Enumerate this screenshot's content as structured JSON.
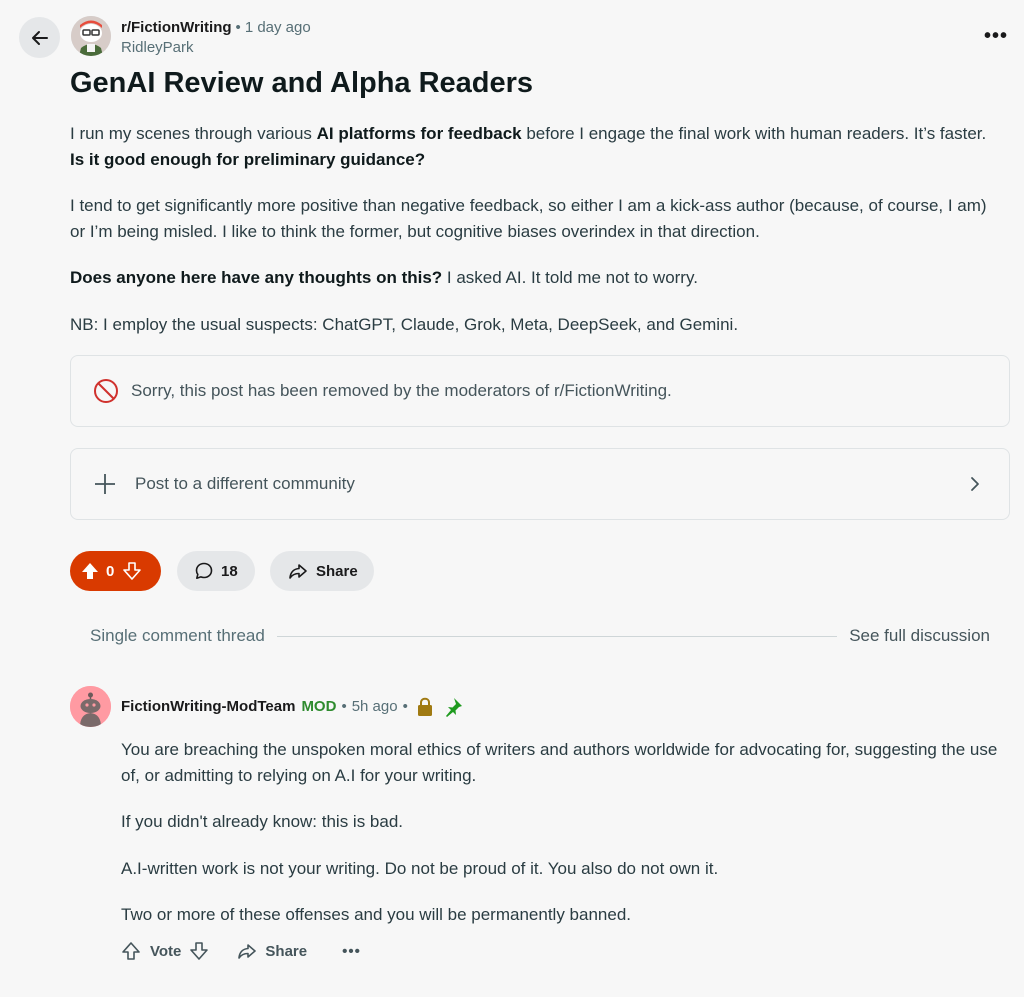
{
  "post": {
    "subreddit": "r/FictionWriting",
    "separator": "•",
    "time": "1 day ago",
    "author": "RidleyPark",
    "more": "•••",
    "title": "GenAI Review and Alpha Readers",
    "p1_a": "I run my scenes through various ",
    "p1_b": "AI platforms for feedback",
    "p1_c": " before I engage the final work with human readers. It’s faster. ",
    "p1_d": "Is it good enough for preliminary guidance?",
    "p2": "I tend to get significantly more positive than negative feedback, so either I am a kick-ass author (because, of course, I am) or I’m being misled. I like to think the former, but cognitive biases overindex in that direction.",
    "p3_a": "Does anyone here have any thoughts on this?",
    "p3_b": " I asked AI. It told me not to worry.",
    "p4": "NB: I employ the usual suspects: ChatGPT, Claude, Grok, Meta, DeepSeek, and Gemini."
  },
  "removed_notice": "Sorry, this post has been removed by the moderators of r/FictionWriting.",
  "crosspost_label": "Post to a different community",
  "actions": {
    "vote_count": "0",
    "comment_count": "18",
    "share_label": "Share"
  },
  "thread": {
    "single_label": "Single comment thread",
    "full_label": "See full discussion"
  },
  "comment": {
    "username": "FictionWriting-ModTeam",
    "mod_badge": "MOD",
    "separator": "•",
    "time": "5h ago",
    "paragraphs": [
      "You are breaching the unspoken moral ethics of writers and authors worldwide for advocating for, suggesting the use of, or admitting to relying on A.I for your writing.",
      "If you didn't already know: this is bad.",
      "A.I-written work is not your writing. Do not be proud of it. You also do not own it.",
      "Two or more of these offenses and you will be permanently banned."
    ],
    "vote_label": "Vote",
    "share_label": "Share",
    "more": "•••"
  },
  "colors": {
    "upvote_active": "#d93a00",
    "mod_green": "#2e8b2e",
    "lock": "#a07a12",
    "pin": "#1e9a1e",
    "removed_icon": "#d0312d"
  },
  "icons": [
    "back-arrow-icon",
    "more-icon",
    "removed-icon",
    "plus-icon",
    "chevron-right-icon",
    "upvote-icon",
    "downvote-icon",
    "comment-icon",
    "share-icon",
    "lock-icon",
    "pin-icon"
  ]
}
